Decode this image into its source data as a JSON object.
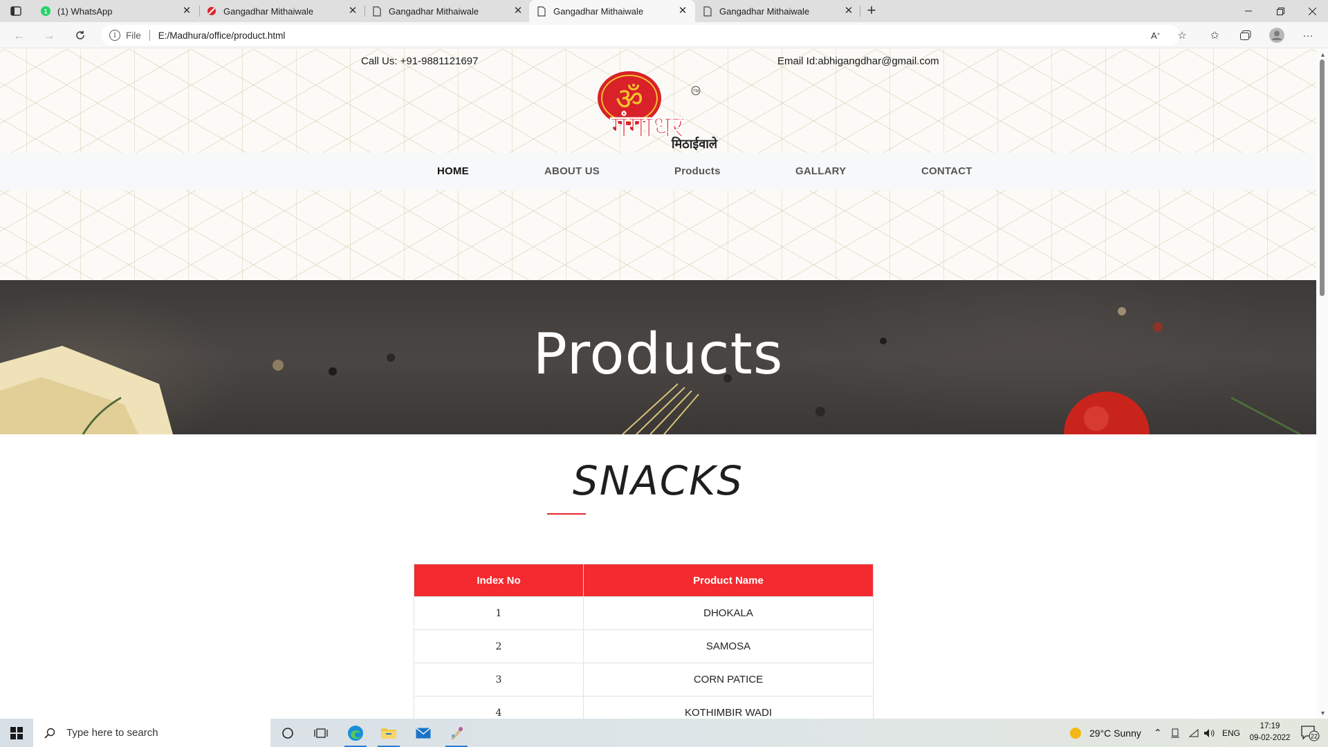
{
  "browser": {
    "tabs": [
      {
        "title": "(1) WhatsApp",
        "favicon": "whatsapp-icon",
        "active": false
      },
      {
        "title": "Gangadhar Mithaiwale",
        "favicon": "site-logo-icon",
        "active": false
      },
      {
        "title": "Gangadhar Mithaiwale",
        "favicon": "page-icon",
        "active": false
      },
      {
        "title": "Gangadhar Mithaiwale",
        "favicon": "page-icon",
        "active": true
      },
      {
        "title": "Gangadhar Mithaiwale",
        "favicon": "page-icon",
        "active": false
      }
    ],
    "address": {
      "scheme": "File",
      "url": "E:/Madhura/office/product.html"
    }
  },
  "site": {
    "call": "Call Us: +91-9881121697",
    "email": "Email Id:abhigangdhar@gmail.com",
    "logo": {
      "script": "ॐ",
      "name": "गंगाधर",
      "sub": "मिठाईवाले",
      "tm": "TM"
    },
    "nav": {
      "home": "HOME",
      "about": "ABOUT US",
      "products": "Products",
      "gallery": "GALLARY",
      "contact": "CONTACT"
    },
    "banner_title": "Products",
    "section_title": "SNACKS",
    "table": {
      "headers": [
        "Index No",
        "Product Name"
      ],
      "rows": [
        {
          "index": "1",
          "name": "DHOKALA"
        },
        {
          "index": "2",
          "name": "SAMOSA"
        },
        {
          "index": "3",
          "name": "CORN PATICE"
        },
        {
          "index": "4",
          "name": "KOTHIMBIR WADI"
        }
      ]
    }
  },
  "taskbar": {
    "search_placeholder": "Type here to search",
    "weather": "29°C  Sunny",
    "language": "ENG",
    "time": "17:19",
    "date": "09-02-2022",
    "notifications": "22"
  },
  "colors": {
    "accent_red": "#f32a2f",
    "underline_red": "#e8242b"
  }
}
